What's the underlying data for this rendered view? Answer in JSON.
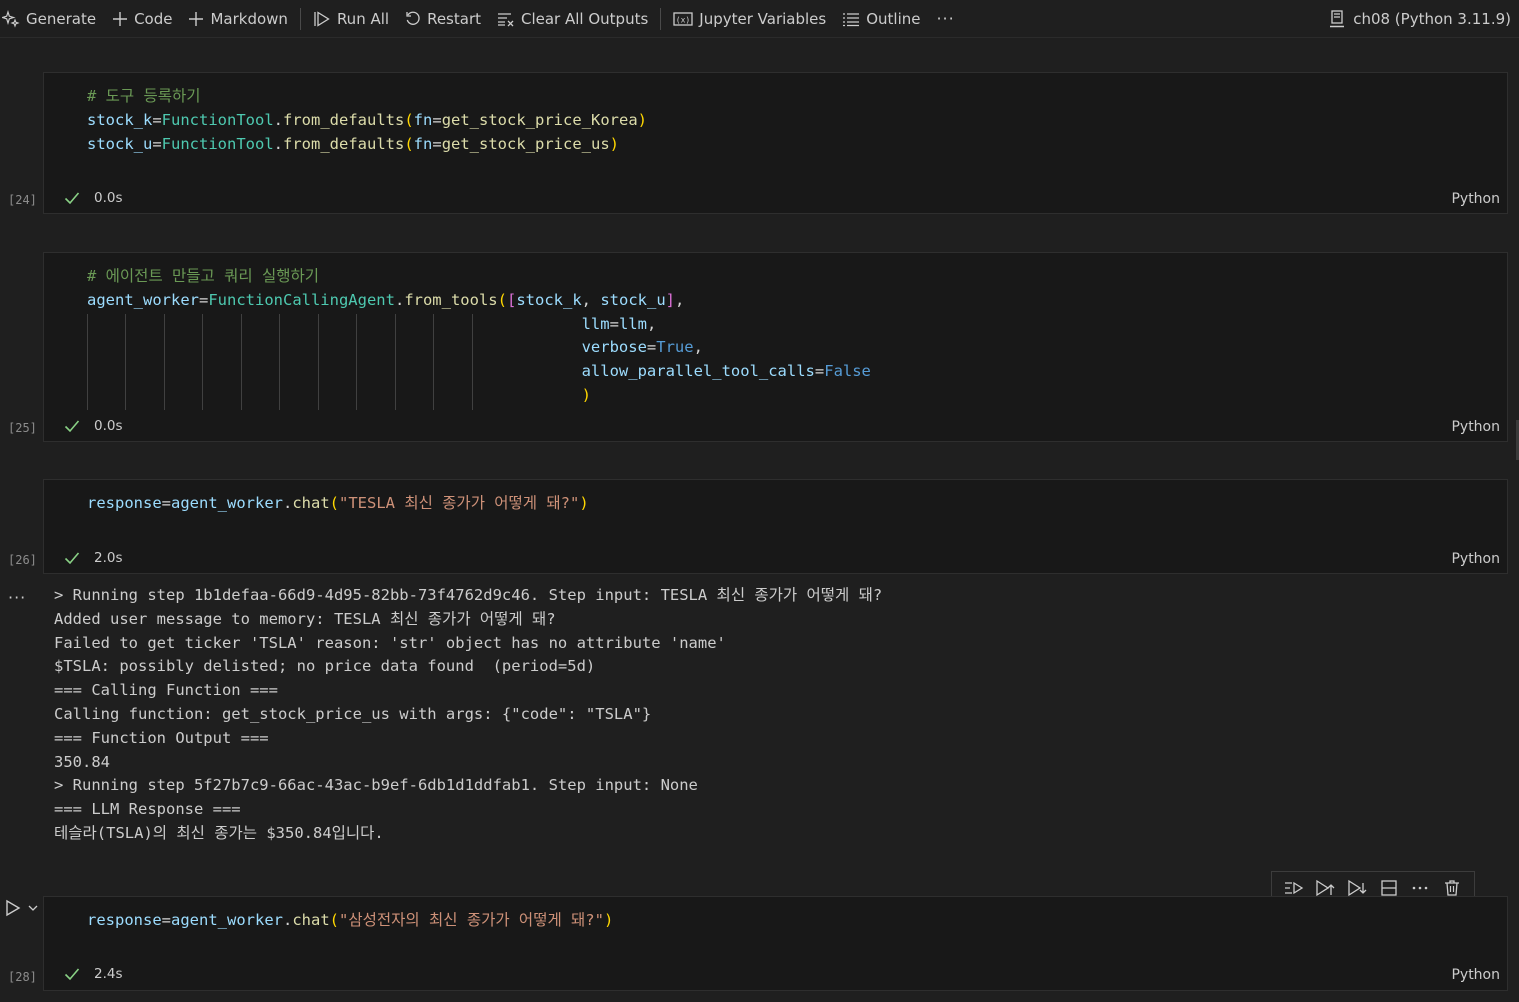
{
  "toolbar": {
    "generate": "Generate",
    "code": "Code",
    "markdown": "Markdown",
    "run_all": "Run All",
    "restart": "Restart",
    "clear_outputs": "Clear All Outputs",
    "variables": "Jupyter Variables",
    "outline": "Outline",
    "more": "···",
    "kernel": "ch08 (Python 3.11.9)"
  },
  "cells": [
    {
      "exec_count": "[24]",
      "time": "0.0s",
      "lang": "Python",
      "comment": "# 도구 등록하기",
      "line1": {
        "var": "stock_k",
        "cls": "FunctionTool",
        "fn": "from_defaults",
        "param": "fn",
        "arg": "get_stock_price_Korea"
      },
      "line2": {
        "var": "stock_u",
        "cls": "FunctionTool",
        "fn": "from_defaults",
        "param": "fn",
        "arg": "get_stock_price_us"
      }
    },
    {
      "exec_count": "[25]",
      "time": "0.0s",
      "lang": "Python",
      "comment": "# 에이전트 만들고 쿼리 실행하기",
      "var": "agent_worker",
      "cls": "FunctionCallingAgent",
      "fn": "from_tools",
      "tool1": "stock_k",
      "tool2": "stock_u",
      "llm_param": "llm",
      "llm_val": "llm",
      "verbose_param": "verbose",
      "verbose_val": "True",
      "parallel_param": "allow_parallel_tool_calls",
      "parallel_val": "False"
    },
    {
      "exec_count": "[26]",
      "time": "2.0s",
      "lang": "Python",
      "var": "response",
      "obj": "agent_worker",
      "fn": "chat",
      "str": "\"TESLA 최신 종가가 어떻게 돼?\""
    },
    {
      "exec_count": "[28]",
      "time": "2.4s",
      "lang": "Python",
      "var": "response",
      "obj": "agent_worker",
      "fn": "chat",
      "str": "\"삼성전자의 최신 종가가 어떻게 돼?\""
    }
  ],
  "output": {
    "more": "···",
    "lines": [
      "> Running step 1b1defaa-66d9-4d95-82bb-73f4762d9c46. Step input: TESLA 최신 종가가 어떻게 돼?",
      "Added user message to memory: TESLA 최신 종가가 어떻게 돼?",
      "Failed to get ticker 'TSLA' reason: 'str' object has no attribute 'name'",
      "$TSLA: possibly delisted; no price data found  (period=5d)",
      "=== Calling Function ===",
      "Calling function: get_stock_price_us with args: {\"code\": \"TSLA\"}",
      "=== Function Output ===",
      "350.84",
      "> Running step 5f27b7c9-66ac-43ac-b9ef-6db1d1ddfab1. Step input: None",
      "=== LLM Response ===",
      "테슬라(TSLA)의 최신 종가는 $350.84입니다."
    ]
  }
}
